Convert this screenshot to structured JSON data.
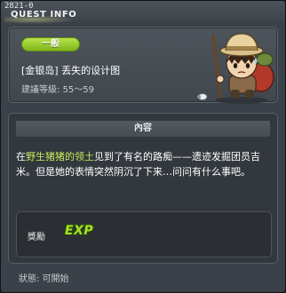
{
  "window": {
    "quest_id": "2821-0",
    "title": "QUEST INFO"
  },
  "header": {
    "category": "一般",
    "quest_name": "[金银岛] 丢失的设计图",
    "level_label": "建議等級:",
    "level_range": "55～59"
  },
  "content": {
    "section_title": "內容",
    "desc_prefix": "在",
    "desc_highlight": "野生猪猪的领土",
    "desc_rest": "见到了有名的路痴——遗迹发掘团员吉米。但是她的表情突然阴沉了下来…问问有什么事吧。"
  },
  "reward": {
    "label": "獎勵",
    "exp_badge": "EXP"
  },
  "status": {
    "text": "狀態: 可開始"
  },
  "colors": {
    "category_green": "#9acd32",
    "highlight_green": "#c8ec5a",
    "exp_green": "#a6e22c"
  }
}
